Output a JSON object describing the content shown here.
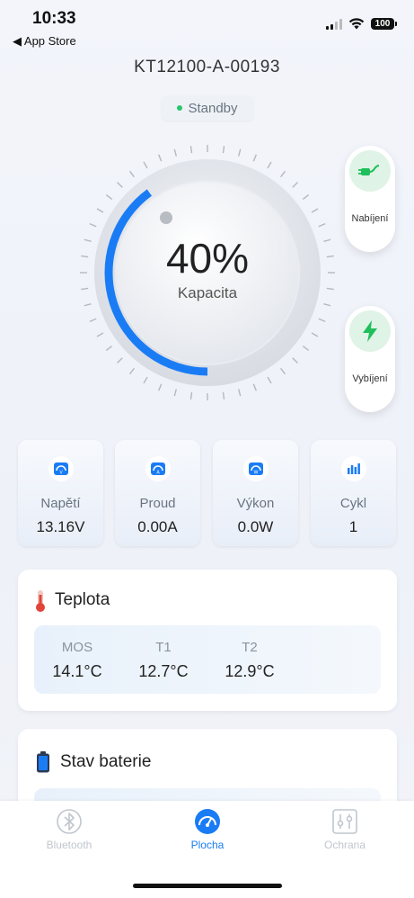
{
  "status_bar": {
    "time": "10:33",
    "back_label": "◀ App Store",
    "battery": "100"
  },
  "device": {
    "title": "KT12100-A-00193",
    "state": "Standby"
  },
  "gauge": {
    "percent_label": "40%",
    "percent": 40,
    "caption": "Kapacita",
    "accent_color": "#1a7cf5"
  },
  "side_buttons": {
    "charge_label": "Nabíjení",
    "discharge_label": "Vybíjení"
  },
  "stats": [
    {
      "label": "Napětí",
      "value": "13.16V",
      "icon": "voltage-gauge-icon"
    },
    {
      "label": "Proud",
      "value": "0.00A",
      "icon": "current-gauge-icon"
    },
    {
      "label": "Výkon",
      "value": "0.0W",
      "icon": "power-gauge-icon"
    },
    {
      "label": "Cykl",
      "value": "1",
      "icon": "bar-chart-icon"
    }
  ],
  "temperature": {
    "title": "Teplota",
    "sensors": [
      {
        "label": "MOS",
        "value": "14.1°C"
      },
      {
        "label": "T1",
        "value": "12.7°C"
      },
      {
        "label": "T2",
        "value": "12.9°C"
      }
    ]
  },
  "battery_state": {
    "title": "Stav baterie"
  },
  "nav": {
    "bluetooth": "Bluetooth",
    "home": "Plocha",
    "protection": "Ochrana",
    "active_color": "#1a7cf5",
    "inactive_color": "#c0c6ce"
  }
}
